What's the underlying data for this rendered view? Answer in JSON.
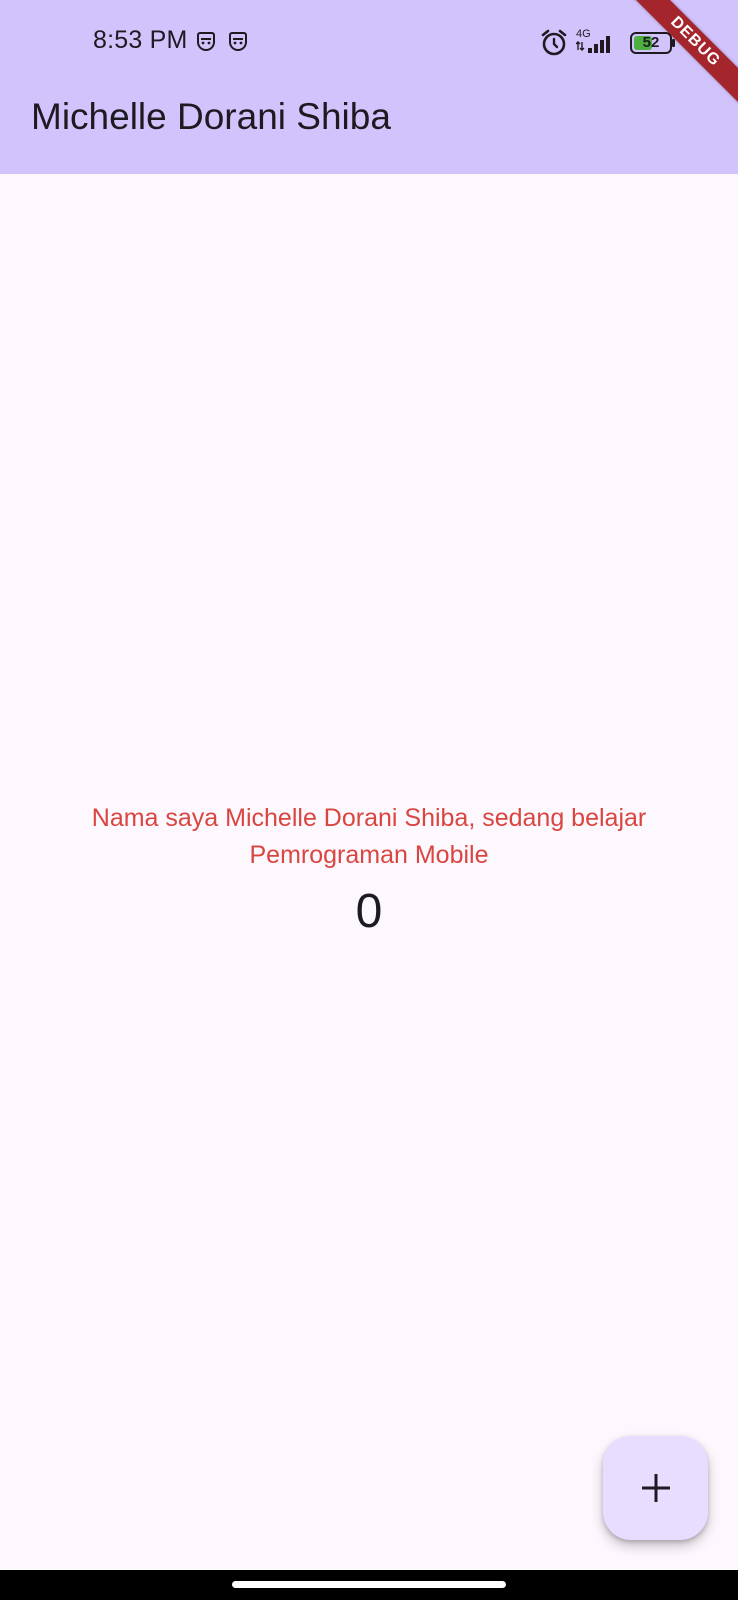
{
  "status_bar": {
    "time": "8:53 PM",
    "network": "4G",
    "battery_level": "52",
    "icons": [
      "sim-icon",
      "sim-icon",
      "alarm-icon",
      "signal-icon",
      "battery-icon"
    ]
  },
  "app_bar": {
    "title": "Michelle Dorani Shiba",
    "color": "#d3c3fd"
  },
  "debug_banner": {
    "label": "DEBUG",
    "color": "#a5252d"
  },
  "body": {
    "intro_text": "Nama saya Michelle Dorani Shiba, sedang belajar Pemrograman Mobile",
    "intro_color": "#d9463f",
    "counter": "0"
  },
  "fab": {
    "icon": "plus-icon",
    "color": "#e9ddff"
  },
  "colors": {
    "background": "#fdf7fe",
    "text": "#1d1b20"
  }
}
